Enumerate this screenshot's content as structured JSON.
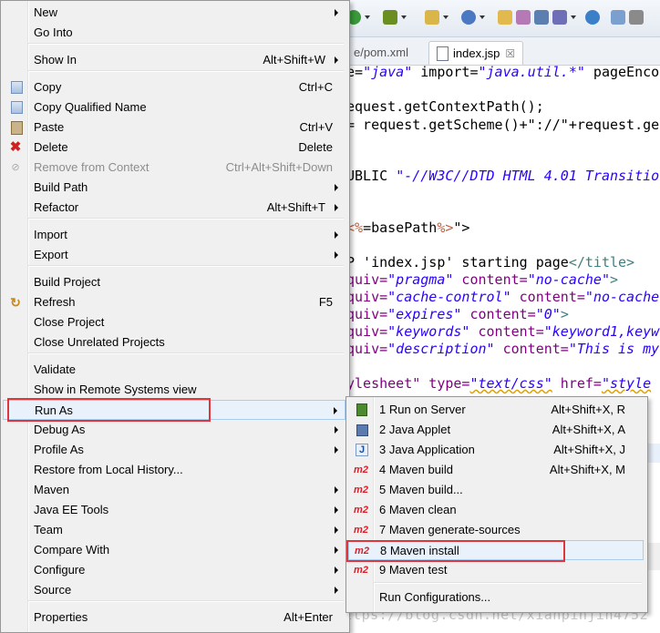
{
  "editor": {
    "tabs": [
      {
        "label": "e/pom.xml"
      },
      {
        "label": "index.jsp",
        "close": "☒"
      }
    ],
    "code_lines": [
      {
        "parts": [
          [
            "plain",
            "e="
          ],
          [
            "s",
            "\"java\""
          ],
          [
            "plain",
            " import="
          ],
          [
            "s",
            "\"java.util.*\""
          ],
          [
            "plain",
            " pageEnco"
          ]
        ]
      },
      {
        "parts": [
          [
            "plain",
            "equest.getContextPath();"
          ]
        ]
      },
      {
        "parts": [
          [
            "plain",
            "= request.getScheme()+\"://\"+request.ge"
          ]
        ]
      },
      {
        "parts": [
          [
            "plain",
            "UBLIC "
          ],
          [
            "s2",
            "\"-//W3C//DTD HTML 4.01 Transitio"
          ]
        ]
      },
      {
        "parts": [
          [
            "jsp",
            "<%"
          ],
          [
            "plain",
            "=basePath"
          ],
          [
            "jsp",
            "%>"
          ],
          [
            "plain",
            "\">"
          ]
        ]
      },
      {
        "parts": [
          [
            "plain",
            "P 'index.jsp' starting page"
          ],
          [
            "tag",
            "</title>"
          ]
        ]
      },
      {
        "parts": [
          [
            "attr",
            "quiv="
          ],
          [
            "s",
            "\"pragma\""
          ],
          [
            "attr",
            " content="
          ],
          [
            "s",
            "\"no-cache\""
          ],
          [
            "tag",
            ">"
          ]
        ]
      },
      {
        "parts": [
          [
            "attr",
            "quiv="
          ],
          [
            "s",
            "\"cache-control\""
          ],
          [
            "attr",
            " content="
          ],
          [
            "s",
            "\"no-cache"
          ]
        ]
      },
      {
        "parts": [
          [
            "attr",
            "quiv="
          ],
          [
            "s",
            "\"expires\""
          ],
          [
            "attr",
            " content="
          ],
          [
            "s",
            "\"0\""
          ],
          [
            "tag",
            ">"
          ]
        ]
      },
      {
        "parts": [
          [
            "attr",
            "quiv="
          ],
          [
            "s",
            "\"keywords\""
          ],
          [
            "attr",
            " content="
          ],
          [
            "s",
            "\"keyword1,keyw"
          ]
        ]
      },
      {
        "parts": [
          [
            "attr",
            "quiv="
          ],
          [
            "s",
            "\"description\""
          ],
          [
            "attr",
            " content="
          ],
          [
            "s",
            "\"This is my"
          ]
        ]
      },
      {
        "parts": [
          [
            "attr",
            "ylesheet\""
          ],
          [
            "attr",
            " type="
          ],
          [
            "s2",
            "\"text/css\""
          ],
          [
            "attr",
            " href="
          ],
          [
            "s2",
            "\"style"
          ]
        ]
      }
    ],
    "watermark": "https://blog.csdn.net/xianpinjin4752"
  },
  "context_menu": {
    "items": [
      {
        "label": "New",
        "submenu": true
      },
      {
        "label": "Go Into"
      },
      {
        "sep": true
      },
      {
        "label": "Show In",
        "accel": "Alt+Shift+W",
        "submenu": true
      },
      {
        "sep": true
      },
      {
        "label": "Copy",
        "accel": "Ctrl+C",
        "icon": "copy-icon"
      },
      {
        "label": "Copy Qualified Name",
        "icon": "copy-qualified-name-icon"
      },
      {
        "label": "Paste",
        "accel": "Ctrl+V",
        "icon": "paste-icon"
      },
      {
        "label": "Delete",
        "accel": "Delete",
        "icon": "delete-icon"
      },
      {
        "label": "Remove from Context",
        "accel": "Ctrl+Alt+Shift+Down",
        "icon": "remove-context-icon",
        "disabled": true
      },
      {
        "label": "Build Path",
        "submenu": true
      },
      {
        "label": "Refactor",
        "accel": "Alt+Shift+T",
        "submenu": true
      },
      {
        "sep": true
      },
      {
        "label": "Import",
        "submenu": true
      },
      {
        "label": "Export",
        "submenu": true
      },
      {
        "sep": true
      },
      {
        "label": "Build Project"
      },
      {
        "label": "Refresh",
        "accel": "F5",
        "icon": "refresh-icon"
      },
      {
        "label": "Close Project"
      },
      {
        "label": "Close Unrelated Projects"
      },
      {
        "sep": true
      },
      {
        "label": "Validate"
      },
      {
        "label": "Show in Remote Systems view"
      },
      {
        "label": "Run As",
        "submenu": true,
        "highlighted": true
      },
      {
        "label": "Debug As",
        "submenu": true
      },
      {
        "label": "Profile As",
        "submenu": true
      },
      {
        "label": "Restore from Local History..."
      },
      {
        "label": "Maven",
        "submenu": true
      },
      {
        "label": "Java EE Tools",
        "submenu": true
      },
      {
        "label": "Team",
        "submenu": true
      },
      {
        "label": "Compare With",
        "submenu": true
      },
      {
        "label": "Configure",
        "submenu": true
      },
      {
        "label": "Source",
        "submenu": true
      },
      {
        "sep": true
      },
      {
        "label": "Properties",
        "accel": "Alt+Enter"
      }
    ]
  },
  "run_as_submenu": {
    "items": [
      {
        "label": "1 Run on Server",
        "accel": "Alt+Shift+X, R",
        "icon": "server-icon"
      },
      {
        "label": "2 Java Applet",
        "accel": "Alt+Shift+X, A",
        "icon": "java-applet-icon"
      },
      {
        "label": "3 Java Application",
        "accel": "Alt+Shift+X, J",
        "icon": "java-application-icon",
        "icon_text": "J"
      },
      {
        "label": "4 Maven build",
        "accel": "Alt+Shift+X, M",
        "icon": "maven-icon",
        "icon_text": "m2"
      },
      {
        "label": "5 Maven build...",
        "icon": "maven-icon",
        "icon_text": "m2"
      },
      {
        "label": "6 Maven clean",
        "icon": "maven-icon",
        "icon_text": "m2"
      },
      {
        "label": "7 Maven generate-sources",
        "icon": "maven-icon",
        "icon_text": "m2"
      },
      {
        "label": "8 Maven install",
        "icon": "maven-icon",
        "icon_text": "m2",
        "highlighted": true
      },
      {
        "label": "9 Maven test",
        "icon": "maven-icon",
        "icon_text": "m2"
      },
      {
        "sep": true
      },
      {
        "label": "Run Configurations..."
      }
    ]
  },
  "colors": {
    "highlight_box": "#e0353a",
    "maven_icon": "#d8202a",
    "hover_fill": "#e9f1fb"
  }
}
